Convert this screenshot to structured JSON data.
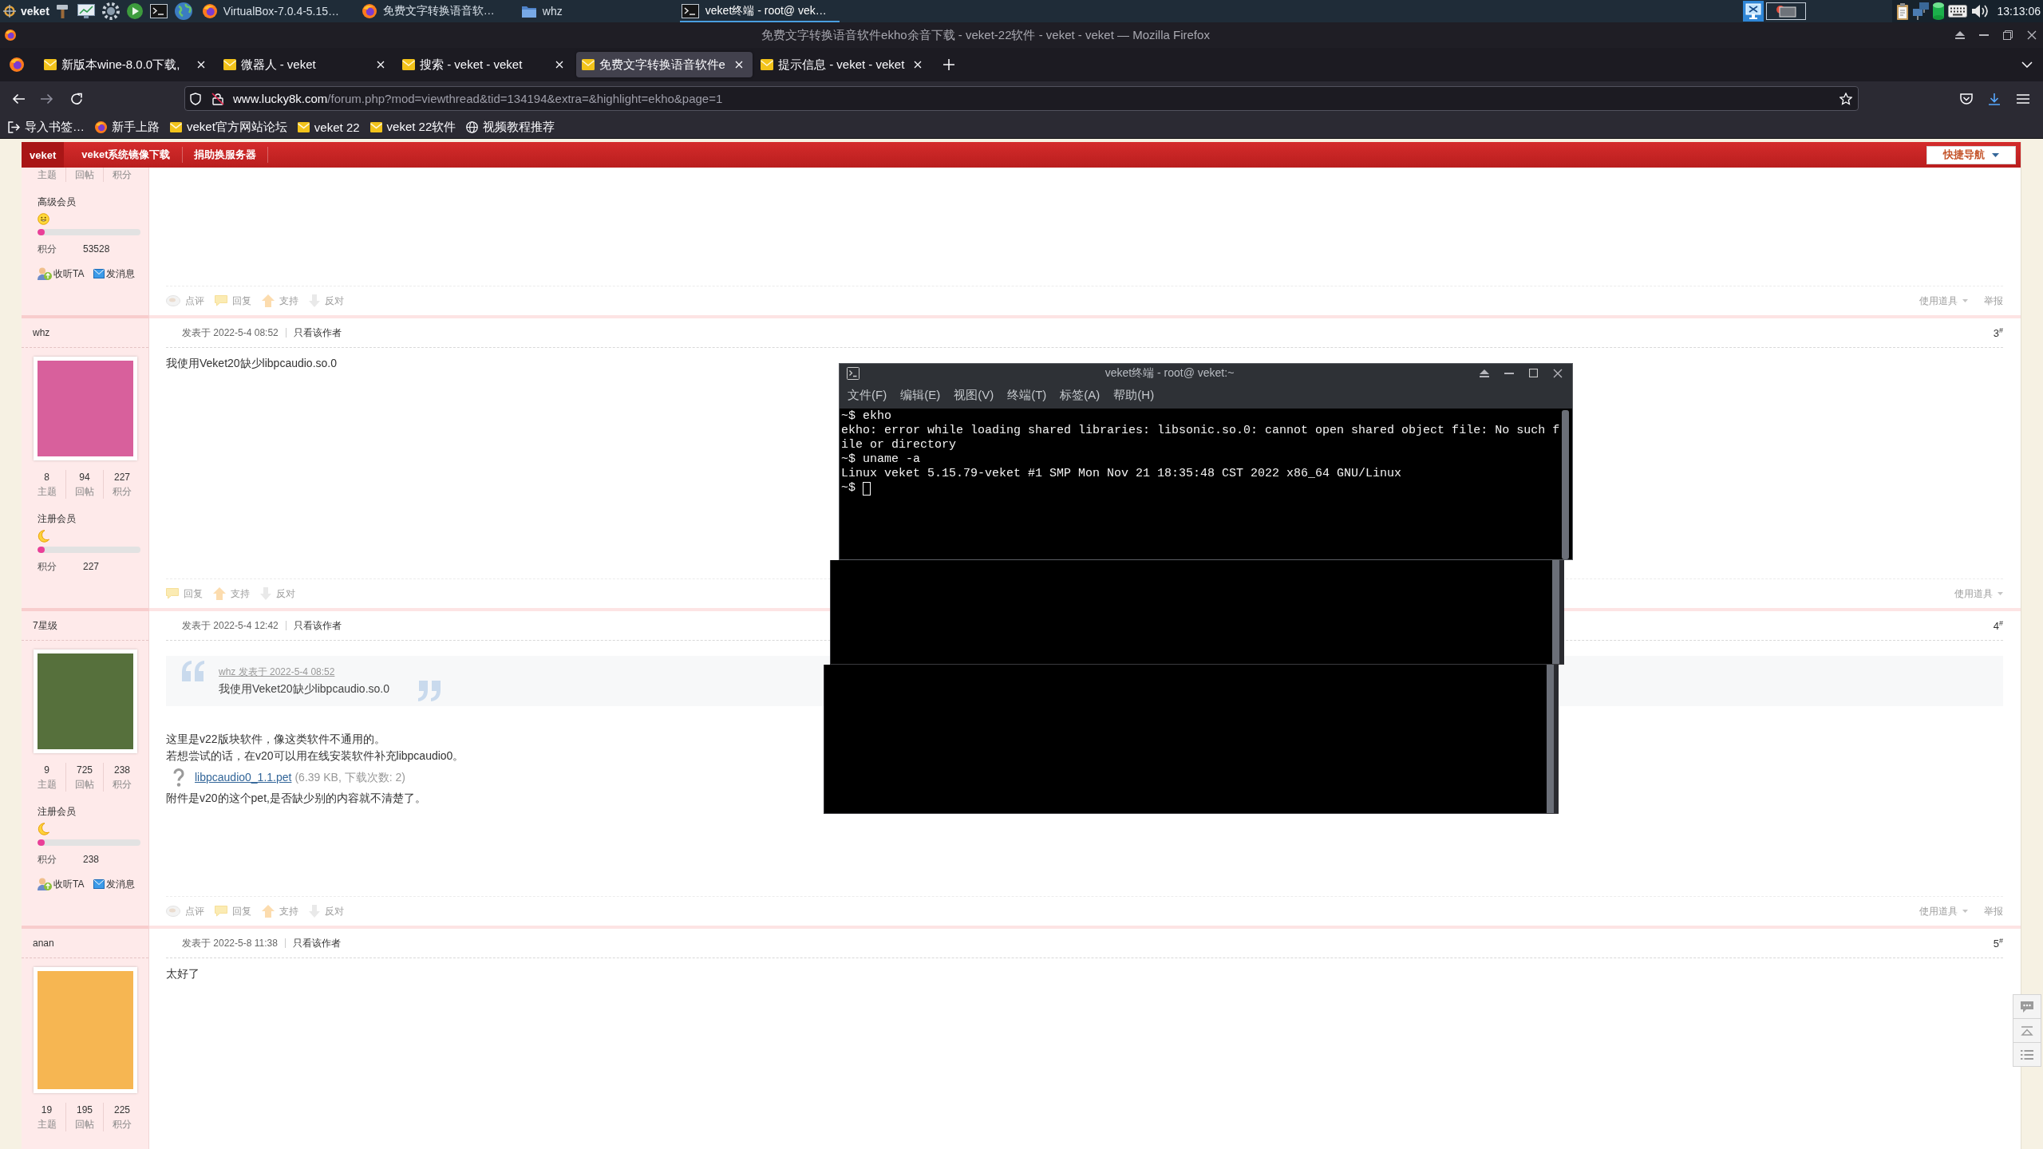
{
  "taskbar": {
    "menu": "veket",
    "tasks": [
      {
        "label": "VirtualBox-7.0.4-5.15…",
        "kind": "browser",
        "selected": false
      },
      {
        "label": "免费文字转换语音软…",
        "kind": "browser",
        "selected": false
      },
      {
        "label": "whz",
        "kind": "folder",
        "selected": false
      },
      {
        "label": "veket终端 - root@ vek…",
        "kind": "terminal",
        "selected": true
      }
    ],
    "clock": "13:13:06"
  },
  "browser": {
    "title": "免费文字转换语音软件ekho余音下载 - veket-22软件 - veket - veket — Mozilla Firefox",
    "tabs": [
      {
        "label": "新版本wine-8.0.0下载,",
        "selected": false
      },
      {
        "label": "微器人 - veket",
        "selected": false
      },
      {
        "label": "搜索 - veket - veket",
        "selected": false
      },
      {
        "label": "免费文字转换语音软件e",
        "selected": true
      },
      {
        "label": "提示信息 - veket - veket",
        "selected": false
      }
    ],
    "address": {
      "host": "www.lucky8k.com",
      "path": "/forum.php?mod=viewthread&tid=134194&extra=&highlight=ekho&page=1"
    },
    "bookmarks": [
      {
        "label": "导入书签…",
        "kind": "import"
      },
      {
        "label": "新手上路",
        "kind": "browser"
      },
      {
        "label": "veket官方网站论坛",
        "kind": "site"
      },
      {
        "label": "veket 22",
        "kind": "site"
      },
      {
        "label": "veket 22软件",
        "kind": "site"
      },
      {
        "label": "视频教程推荐",
        "kind": "globe"
      }
    ]
  },
  "forum": {
    "nav": [
      {
        "label": "veket",
        "selected": true
      },
      {
        "label": "veket系统镜像下载",
        "selected": false
      },
      {
        "label": "捐助换服务器",
        "selected": false
      }
    ],
    "quick_nav": "快捷导航",
    "posts": [
      {
        "stats": [
          {
            "label": "主题"
          },
          {
            "label": "回帖"
          },
          {
            "label": "积分"
          }
        ],
        "group": "高级会员",
        "rank_icon": {
          "kind": "smiley"
        },
        "level": 0.07,
        "credits_label": "积分",
        "credits": "53528",
        "links": [
          {
            "kind": "follow",
            "label": "收听TA"
          },
          {
            "kind": "message",
            "label": "发消息"
          }
        ],
        "actions": [
          {
            "kind": "comment",
            "label": "点评"
          },
          {
            "kind": "reply",
            "label": "回复"
          },
          {
            "kind": "support",
            "label": "支持"
          },
          {
            "kind": "oppose",
            "label": "反对"
          }
        ],
        "tools": [
          {
            "kind": "props",
            "label": "使用道具"
          },
          {
            "kind": "report",
            "label": "举报"
          }
        ]
      },
      {
        "author": "whz",
        "posted": "发表于 2022-5-4 08:52",
        "author_only": "只看该作者",
        "floor": "3$^{#}$",
        "avatar": {
          "kind": "square",
          "color": "#d8609c"
        },
        "stats": [
          {
            "value": "8",
            "label": "主题"
          },
          {
            "value": "94",
            "label": "回帖"
          },
          {
            "value": "227",
            "label": "积分"
          }
        ],
        "group": "注册会员",
        "rank_icon": {
          "kind": "moon"
        },
        "level": 0.07,
        "credits_label": "积分",
        "credits": "227",
        "content": [
          {
            "kind": "text",
            "text": "我使用Veket20缺少libpcaudio.so.0"
          }
        ],
        "actions": [
          {
            "kind": "reply",
            "label": "回复"
          },
          {
            "kind": "support",
            "label": "支持"
          },
          {
            "kind": "oppose",
            "label": "反对"
          }
        ],
        "tools": [
          {
            "kind": "props",
            "label": "使用道具"
          }
        ]
      },
      {
        "author": "7星级",
        "posted": "发表于 2022-5-4 12:42",
        "author_only": "只看该作者",
        "floor": "4$^{#}$",
        "avatar": {
          "kind": "square",
          "color": "#56703c"
        },
        "stats": [
          {
            "value": "9",
            "label": "主题"
          },
          {
            "value": "725",
            "label": "回帖"
          },
          {
            "value": "238",
            "label": "积分"
          }
        ],
        "group": "注册会员",
        "rank_icon": {
          "kind": "moon"
        },
        "level": 0.07,
        "credits_label": "积分",
        "credits": "238",
        "links": [
          {
            "kind": "follow",
            "label": "收听TA"
          },
          {
            "kind": "message",
            "label": "发消息"
          }
        ],
        "content": [
          {
            "kind": "quote",
            "source": "whz 发表于 2022-5-4 08:52",
            "text": "我使用Veket20缺少libpcaudio.so.0"
          },
          {
            "kind": "text",
            "text": "这里是v22版块软件，像这类软件不通用的。"
          },
          {
            "kind": "text",
            "text": "若想尝试的话，在v20可以用在线安装软件补充libpcaudio0。"
          },
          {
            "kind": "attachment",
            "file": "libpcaudio0_1.1.pet",
            "info": "(6.39 KB, 下载次数: 2)"
          },
          {
            "kind": "text",
            "text": "附件是v20的这个pet,是否缺少别的内容就不清楚了。"
          }
        ],
        "actions": [
          {
            "kind": "comment",
            "label": "点评"
          },
          {
            "kind": "reply",
            "label": "回复"
          },
          {
            "kind": "support",
            "label": "支持"
          },
          {
            "kind": "oppose",
            "label": "反对"
          }
        ],
        "tools": [
          {
            "kind": "props",
            "label": "使用道具"
          },
          {
            "kind": "report",
            "label": "举报"
          }
        ]
      },
      {
        "author": "anan",
        "posted": "发表于 2022-5-8 11:38",
        "author_only": "只看该作者",
        "floor": "5$^{#}$",
        "avatar": {
          "kind": "portrait",
          "color": "#f6b652"
        },
        "stats": [
          {
            "value": "19",
            "label": "主题"
          },
          {
            "value": "195",
            "label": "回帖"
          },
          {
            "value": "225",
            "label": "积分"
          }
        ],
        "content": [
          {
            "kind": "text",
            "text": "太好了"
          }
        ]
      }
    ]
  },
  "terminal": {
    "title": "veket终端 - root@ veket:~",
    "menu": [
      "文件(F)",
      "编辑(E)",
      "视图(V)",
      "终端(T)",
      "标签(A)",
      "帮助(H)"
    ],
    "lines": [
      "~$ ekho",
      "ekho: error while loading shared libraries: libsonic.so.0: cannot open shared object file: No such f",
      "ile or directory",
      "~$ uname -a",
      "Linux veket 5.15.79-veket #1 SMP Mon Nov 21 18:35:48 CST 2022 x86_64 GNU/Linux"
    ],
    "prompt": "~$"
  }
}
